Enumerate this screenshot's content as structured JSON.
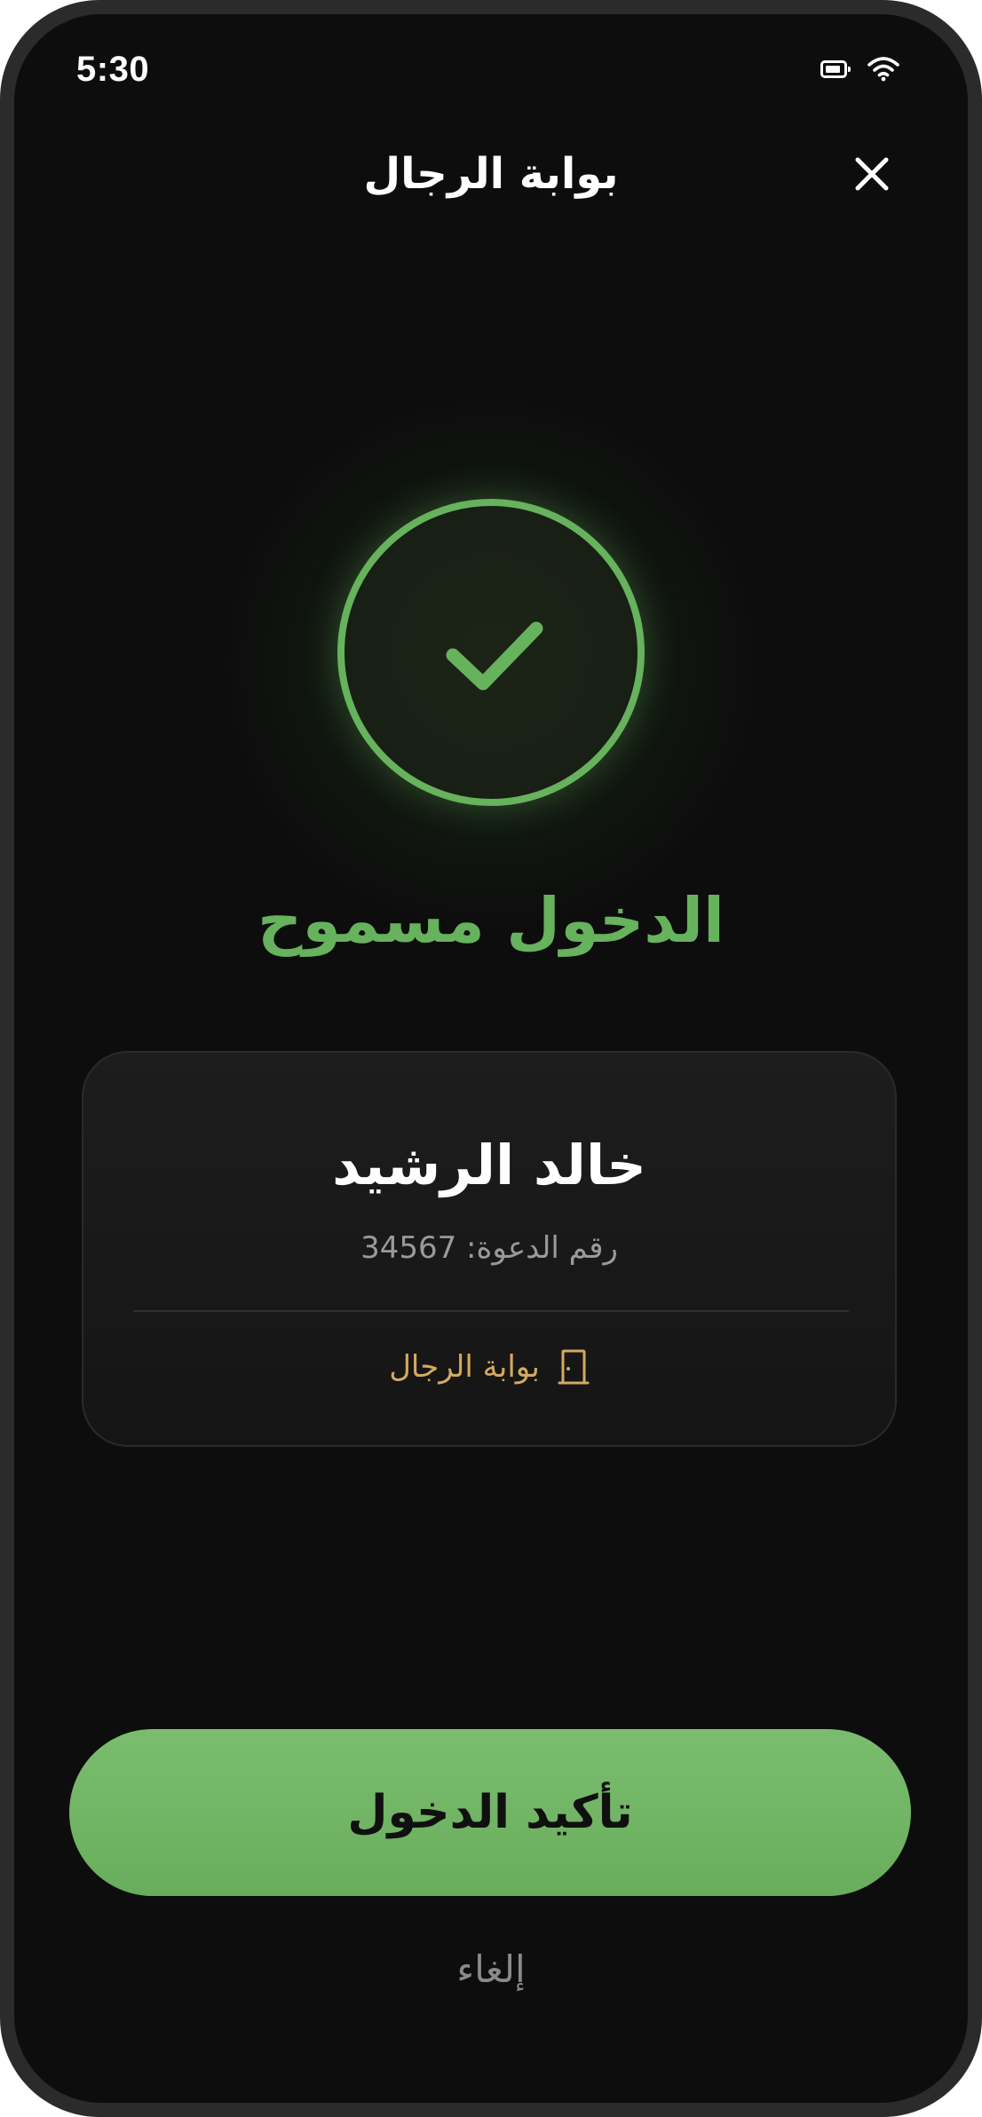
{
  "status_bar": {
    "time": "5:30",
    "icons": [
      "battery-icon",
      "wifi-icon"
    ]
  },
  "header": {
    "title": "بوابة الرجال",
    "close_icon": "close-icon"
  },
  "result": {
    "icon": "check-circle-icon",
    "title": "الدخول مسموح",
    "accent_color": "#67b25d"
  },
  "guest": {
    "name": "خالد الرشيد",
    "invite_label": "رقم الدعوة:",
    "invite_number": "34567",
    "gate_icon": "door-icon",
    "gate_name": "بوابة الرجال",
    "gate_color": "#d4aa5e"
  },
  "actions": {
    "confirm_label": "تأكيد الدخول",
    "cancel_label": "إلغاء",
    "confirm_color": "#72b566"
  }
}
